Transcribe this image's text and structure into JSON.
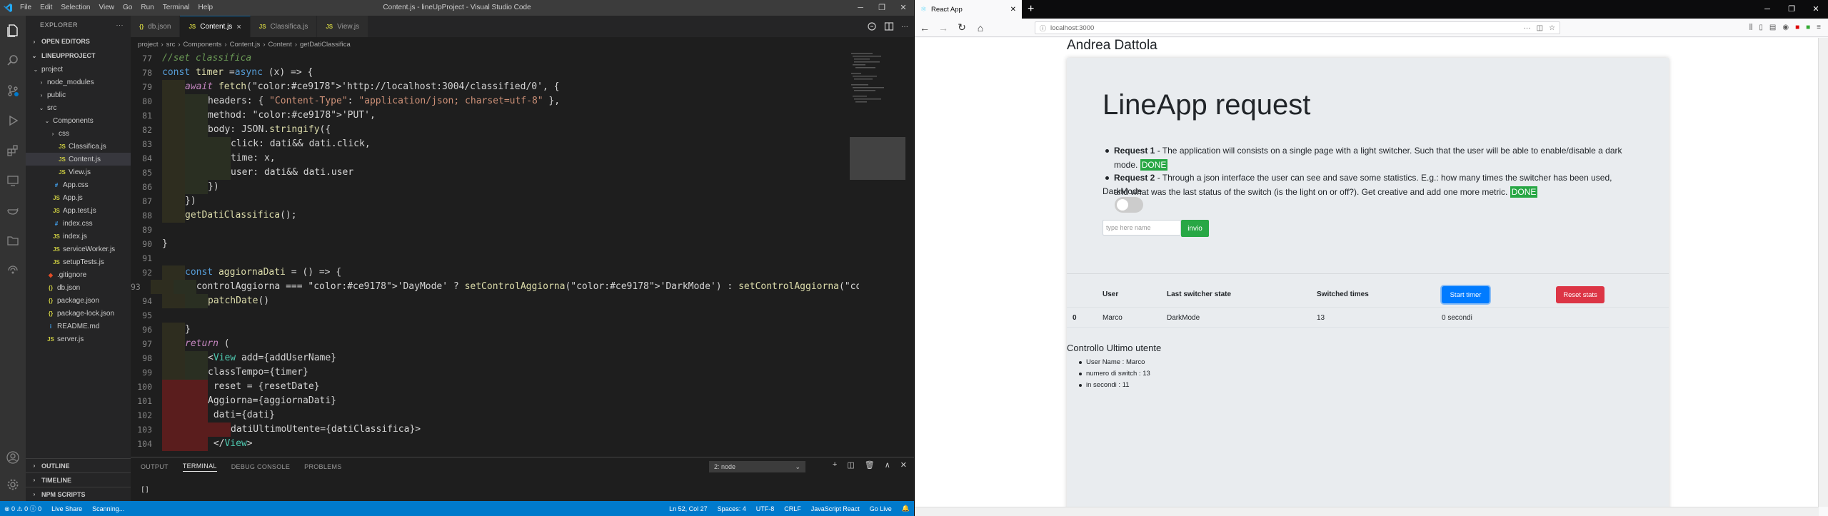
{
  "vscode": {
    "window_title": "Content.js - lineUpProject - Visual Studio Code",
    "menu": [
      "File",
      "Edit",
      "Selection",
      "View",
      "Go",
      "Run",
      "Terminal",
      "Help"
    ],
    "explorer": {
      "title": "EXPLORER",
      "open_editors": "OPEN EDITORS",
      "project": "LINEUPPROJECT",
      "tree": [
        {
          "label": "project",
          "indent": 1,
          "kind": "folder-open",
          "icon": ""
        },
        {
          "label": "node_modules",
          "indent": 2,
          "kind": "folder",
          "icon": ""
        },
        {
          "label": "public",
          "indent": 2,
          "kind": "folder",
          "icon": ""
        },
        {
          "label": "src",
          "indent": 2,
          "kind": "folder-open",
          "icon": ""
        },
        {
          "label": "Components",
          "indent": 3,
          "kind": "folder-open",
          "icon": ""
        },
        {
          "label": "css",
          "indent": 4,
          "kind": "folder",
          "icon": ""
        },
        {
          "label": "Classifica.js",
          "indent": 4,
          "kind": "file",
          "icon": "JS"
        },
        {
          "label": "Content.js",
          "indent": 4,
          "kind": "file",
          "icon": "JS",
          "selected": true
        },
        {
          "label": "View.js",
          "indent": 4,
          "kind": "file",
          "icon": "JS"
        },
        {
          "label": "App.css",
          "indent": 3,
          "kind": "file",
          "icon": "#"
        },
        {
          "label": "App.js",
          "indent": 3,
          "kind": "file",
          "icon": "JS"
        },
        {
          "label": "App.test.js",
          "indent": 3,
          "kind": "file",
          "icon": "JS"
        },
        {
          "label": "index.css",
          "indent": 3,
          "kind": "file",
          "icon": "#"
        },
        {
          "label": "index.js",
          "indent": 3,
          "kind": "file",
          "icon": "JS"
        },
        {
          "label": "serviceWorker.js",
          "indent": 3,
          "kind": "file",
          "icon": "JS"
        },
        {
          "label": "setupTests.js",
          "indent": 3,
          "kind": "file",
          "icon": "JS"
        },
        {
          "label": ".gitignore",
          "indent": 2,
          "kind": "file",
          "icon": "◆"
        },
        {
          "label": "db.json",
          "indent": 2,
          "kind": "file",
          "icon": "{}"
        },
        {
          "label": "package.json",
          "indent": 2,
          "kind": "file",
          "icon": "{}"
        },
        {
          "label": "package-lock.json",
          "indent": 2,
          "kind": "file",
          "icon": "{}"
        },
        {
          "label": "README.md",
          "indent": 2,
          "kind": "file",
          "icon": "i"
        },
        {
          "label": "server.js",
          "indent": 2,
          "kind": "file",
          "icon": "JS"
        }
      ],
      "bottom_sections": [
        "OUTLINE",
        "TIMELINE",
        "NPM SCRIPTS"
      ]
    },
    "tabs": [
      {
        "label": "db.json",
        "icon": "{}",
        "active": false
      },
      {
        "label": "Content.js",
        "icon": "JS",
        "active": true
      },
      {
        "label": "Classifica.js",
        "icon": "JS",
        "active": false
      },
      {
        "label": "View.js",
        "icon": "JS",
        "active": false
      }
    ],
    "tab_close": "×",
    "breadcrumb": [
      "project",
      "src",
      "Components",
      "Content.js",
      "Content",
      "getDatiClassifica"
    ],
    "code": [
      {
        "n": "77",
        "t": "//set classifica",
        "c": "comment",
        "indent": 0
      },
      {
        "n": "78",
        "t": "const timer =async (x) => {",
        "c": "def",
        "indent": 0
      },
      {
        "n": "79",
        "t": "await fetch('http://localhost:3004/classified/0', {",
        "c": "await",
        "indent": 1
      },
      {
        "n": "80",
        "t": "headers: { \"Content-Type\": \"application/json; charset=utf-8\" },",
        "c": "prop",
        "indent": 2
      },
      {
        "n": "81",
        "t": "method: 'PUT',",
        "c": "prop",
        "indent": 2
      },
      {
        "n": "82",
        "t": "body: JSON.stringify({",
        "c": "prop",
        "indent": 2
      },
      {
        "n": "83",
        "t": "click: dati&& dati.click,",
        "c": "prop",
        "indent": 3
      },
      {
        "n": "84",
        "t": "time: x,",
        "c": "prop",
        "indent": 3
      },
      {
        "n": "85",
        "t": "user: dati&& dati.user",
        "c": "prop",
        "indent": 3
      },
      {
        "n": "86",
        "t": "})",
        "c": "plain",
        "indent": 2
      },
      {
        "n": "87",
        "t": "})",
        "c": "plain",
        "indent": 1
      },
      {
        "n": "88",
        "t": "getDatiClassifica();",
        "c": "call",
        "indent": 1
      },
      {
        "n": "89",
        "t": "",
        "c": "plain",
        "indent": 0
      },
      {
        "n": "90",
        "t": "}",
        "c": "plain",
        "indent": 0
      },
      {
        "n": "91",
        "t": "",
        "c": "plain",
        "indent": 0
      },
      {
        "n": "92",
        "t": "const aggiornaDati = () => {",
        "c": "def",
        "indent": 1
      },
      {
        "n": "93",
        "t": "controlAggiorna === 'DayMode' ? setControlAggiorna('DarkMode') : setControlAggiorna('DayMode')",
        "c": "prop",
        "indent": 2
      },
      {
        "n": "94",
        "t": "patchDate()",
        "c": "call",
        "indent": 2
      },
      {
        "n": "95",
        "t": "",
        "c": "plain",
        "indent": 0
      },
      {
        "n": "96",
        "t": "}",
        "c": "plain",
        "indent": 1
      },
      {
        "n": "97",
        "t": "return (",
        "c": "return",
        "indent": 1
      },
      {
        "n": "98",
        "t": "<View add={addUserName}",
        "c": "jsx",
        "indent": 2
      },
      {
        "n": "99",
        "t": "classTempo={timer}",
        "c": "jsx",
        "indent": 2
      },
      {
        "n": "100",
        "t": " reset = {resetDate}",
        "c": "jsx",
        "indent": 2,
        "err": true
      },
      {
        "n": "101",
        "t": "Aggiorna={aggiornaDati}",
        "c": "jsx",
        "indent": 2,
        "err": true
      },
      {
        "n": "102",
        "t": " dati={dati}",
        "c": "jsx",
        "indent": 2,
        "err": true
      },
      {
        "n": "103",
        "t": "datiUltimoUtente={datiClassifica}>",
        "c": "jsx",
        "indent": 3,
        "err": true
      },
      {
        "n": "104",
        "t": " </View>",
        "c": "jsx",
        "indent": 2,
        "err": true
      }
    ],
    "panel": {
      "tabs": [
        "OUTPUT",
        "TERMINAL",
        "DEBUG CONSOLE",
        "PROBLEMS"
      ],
      "active_tab": "TERMINAL",
      "terminal_select": "2: node",
      "prompt": "[]"
    },
    "status": {
      "left": [
        "⊗ 0 ⚠ 0 ⓘ 0",
        "Live Share",
        "Scanning..."
      ],
      "right": [
        "Ln 52, Col 27",
        "Spaces: 4",
        "UTF-8",
        "CRLF",
        "JavaScript React",
        "Go Live"
      ]
    }
  },
  "browser": {
    "tab_title": "React App",
    "url": "localhost:3000",
    "page": {
      "author": "Andrea Dattola",
      "title": "LineApp request",
      "requests": [
        {
          "label": "Request 1",
          "text": " - The application will consists on a single page with a light switcher. Such that the user will be able to enable/disable a dark mode.",
          "badge": "DONE"
        },
        {
          "label": "Request 2",
          "text": " - Through a json interface the user can see and save some statistics. E.g.: how many times the switcher has been used, and what was the last status of the switch (is the light on or off?). Get creative and add one more metric.",
          "badge": "DONE"
        }
      ],
      "darkmode_label": "DarkMode",
      "darkmode_on": false,
      "input_placeholder": "type here name",
      "invio": "invio",
      "table": {
        "headers": [
          "User",
          "Last switcher state",
          "Switched times"
        ],
        "start_button": "Start timer",
        "reset_button": "Reset stats",
        "rows": [
          {
            "index": "0",
            "user": "Marco",
            "state": "DarkMode",
            "times": "13",
            "time": "0 secondi"
          }
        ]
      },
      "controllo": {
        "title": "Controllo Ultimo utente",
        "items": [
          "User Name : Marco",
          "numero di switch : 13",
          "in secondi : 11"
        ]
      }
    }
  },
  "colors": {
    "vs_accent": "#007acc",
    "done_green": "#28a745",
    "primary": "#007bff",
    "danger": "#dc3545"
  },
  "icons": [
    "vscode-logo-icon",
    "explorer-icon",
    "search-icon",
    "source-control-icon",
    "run-debug-icon",
    "extensions-icon",
    "remote-explorer-icon",
    "live-share-icon",
    "account-icon",
    "settings-gear-icon",
    "back-icon",
    "forward-icon",
    "reload-icon",
    "home-icon",
    "firefox-icon"
  ]
}
